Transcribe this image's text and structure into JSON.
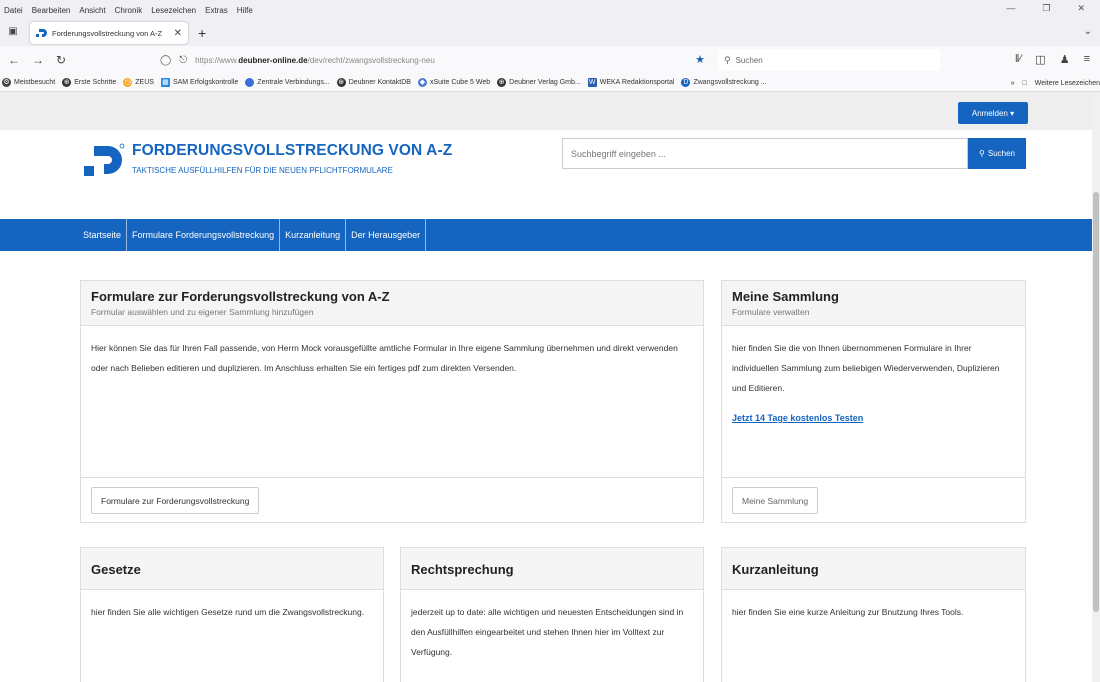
{
  "browser": {
    "menu": [
      "Datei",
      "Bearbeiten",
      "Ansicht",
      "Chronik",
      "Lesezeichen",
      "Extras",
      "Hilfe"
    ],
    "tab_title": "Forderungsvollstreckung von A-Z",
    "url_prefix": "https://www.",
    "url_domain": "deubner-online.de",
    "url_path": "/dev/recht/zwangsvollstreckung-neu",
    "search_placeholder": "Suchen",
    "bookmarks": [
      {
        "label": "Meistbesucht",
        "icon": "gear-icon"
      },
      {
        "label": "Erste Schritte",
        "icon": "globe-icon"
      },
      {
        "label": "ZEUS",
        "icon": "clock-icon"
      },
      {
        "label": "SAM Erfolgskontrolle",
        "icon": "bar-chart-icon"
      },
      {
        "label": "Zentrale Verbindungs...",
        "icon": "blue-circle-icon"
      },
      {
        "label": "Deubner KontaktDB",
        "icon": "globe-icon"
      },
      {
        "label": "xSuite Cube 5 Web",
        "icon": "cube-icon"
      },
      {
        "label": "Deubner Verlag Gmb...",
        "icon": "globe-icon"
      },
      {
        "label": "WEKA Redaktionsportal",
        "icon": "weka-icon"
      },
      {
        "label": "Zwangsvollstreckung ...",
        "icon": "deubner-icon"
      }
    ],
    "bookmarks_more": "Weitere Lesezeichen"
  },
  "site": {
    "login_label": "Anmelden",
    "brand_title": "FORDERUNGSVOLLSTRECKUNG VON A-Z",
    "brand_subtitle": "TAKTISCHE AUSFÜLLHILFEN FÜR DIE NEUEN PFLICHTFORMULARE",
    "search_placeholder": "Suchbegriff eingeben ...",
    "search_button": "Suchen",
    "nav": [
      "Startseite",
      "Formulare Forderungsvollstreckung",
      "Kurzanleitung",
      "Der Herausgeber"
    ],
    "accent_color": "#1565c0"
  },
  "panels": {
    "formulare": {
      "title": "Formulare zur Forderungsvollstreckung von A-Z",
      "subtitle": "Formular auswählen und zu eigener Sammlung hinzufügen",
      "body": "Hier können Sie das für Ihren Fall passende, von Herrn Mock vorausgefüllte amtliche Formular in Ihre eigene Sammlung übernehmen und direkt verwenden oder nach Belieben editieren und duplizieren. Im Anschluss erhalten Sie ein fertiges pdf zum direkten Versenden.",
      "button": "Formulare zur Forderungsvollstreckung"
    },
    "sammlung": {
      "title": "Meine Sammlung",
      "subtitle": "Formulare verwalten",
      "body": "hier finden Sie die von Ihnen übernommenen Formulare in Ihrer individuellen Sammlung zum beliebigen Wiederverwenden, Duplizieren und Editieren.",
      "link": "Jetzt 14 Tage kostenlos Testen",
      "button": "Meine Sammlung"
    },
    "gesetze": {
      "title": "Gesetze",
      "body": "hier finden Sie alle wichtigen Gesetze rund um die Zwangsvollstreckung."
    },
    "rechtsprechung": {
      "title": "Rechtsprechung",
      "body": "jederzeit up to date: alle wichtigen und neuesten Entscheidungen sind in den Ausfüllhilfen eingearbeitet und stehen Ihnen hier im Volltext zur Verfügung."
    },
    "kurzanleitung": {
      "title": "Kurzanleitung",
      "body": "hier finden Sie eine kurze Anleitung zur Bnutzung Ihres Tools."
    }
  }
}
